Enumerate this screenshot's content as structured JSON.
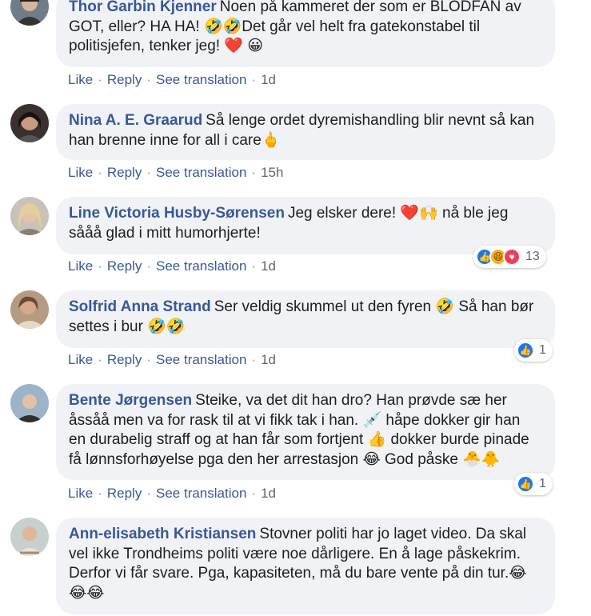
{
  "comments": [
    {
      "author": "Thor Garbin Kjenner",
      "text": "Noen på kammeret der som er BLODFAN av GOT, eller? HA HA! 🤣🤣Det går vel helt fra gatekonstabel til politisjefen, tenker jeg! ❤️ 😀",
      "like": "Like",
      "reply": "Reply",
      "translate": "See translation",
      "time": "1d"
    },
    {
      "author": "Nina A. E. Graarud",
      "text": "Så lenge ordet dyremishandling blir nevnt så kan han brenne inne for all i care🖕",
      "like": "Like",
      "reply": "Reply",
      "translate": "See translation",
      "time": "15h"
    },
    {
      "author": "Line Victoria Husby-Sørensen",
      "text": "Jeg elsker dere! ❤️🙌 nå ble jeg sååå glad i mitt humorhjerte!",
      "like": "Like",
      "reply": "Reply",
      "translate": "See translation",
      "time": "1d",
      "reaction_count": "13"
    },
    {
      "author": "Solfrid Anna Strand",
      "text": "Ser veldig skummel ut den fyren 🤣 Så han bør settes i bur 🤣🤣",
      "like": "Like",
      "reply": "Reply",
      "translate": "See translation",
      "time": "1d",
      "reaction_count": "1"
    },
    {
      "author": "Bente Jørgensen",
      "text": "Steike, va det dit han dro? Han prøvde sæ her åssåå men va for rask til at vi fikk tak i han. 💉 håpe dokker gir han en durabelig straff og at han får som fortjent 👍 dokker burde pinade få lønnsforhøyelse pga den her arrestasjon 😂 God påske 🐣🐥",
      "like": "Like",
      "reply": "Reply",
      "translate": "See translation",
      "time": "1d",
      "reaction_count": "1"
    },
    {
      "author": "Ann-elisabeth Kristiansen",
      "text": "Stovner politi har jo laget video. Da skal vel ikke Trondheims politi være noe dårligere. En å lage påskekrim. Derfor vi får svare. Pga, kapasiteten, må du bare vente på din tur.😂😂😂"
    }
  ],
  "colors": {
    "link": "#385898",
    "bubble": "#f0f2f5",
    "like": "#1877f2"
  }
}
